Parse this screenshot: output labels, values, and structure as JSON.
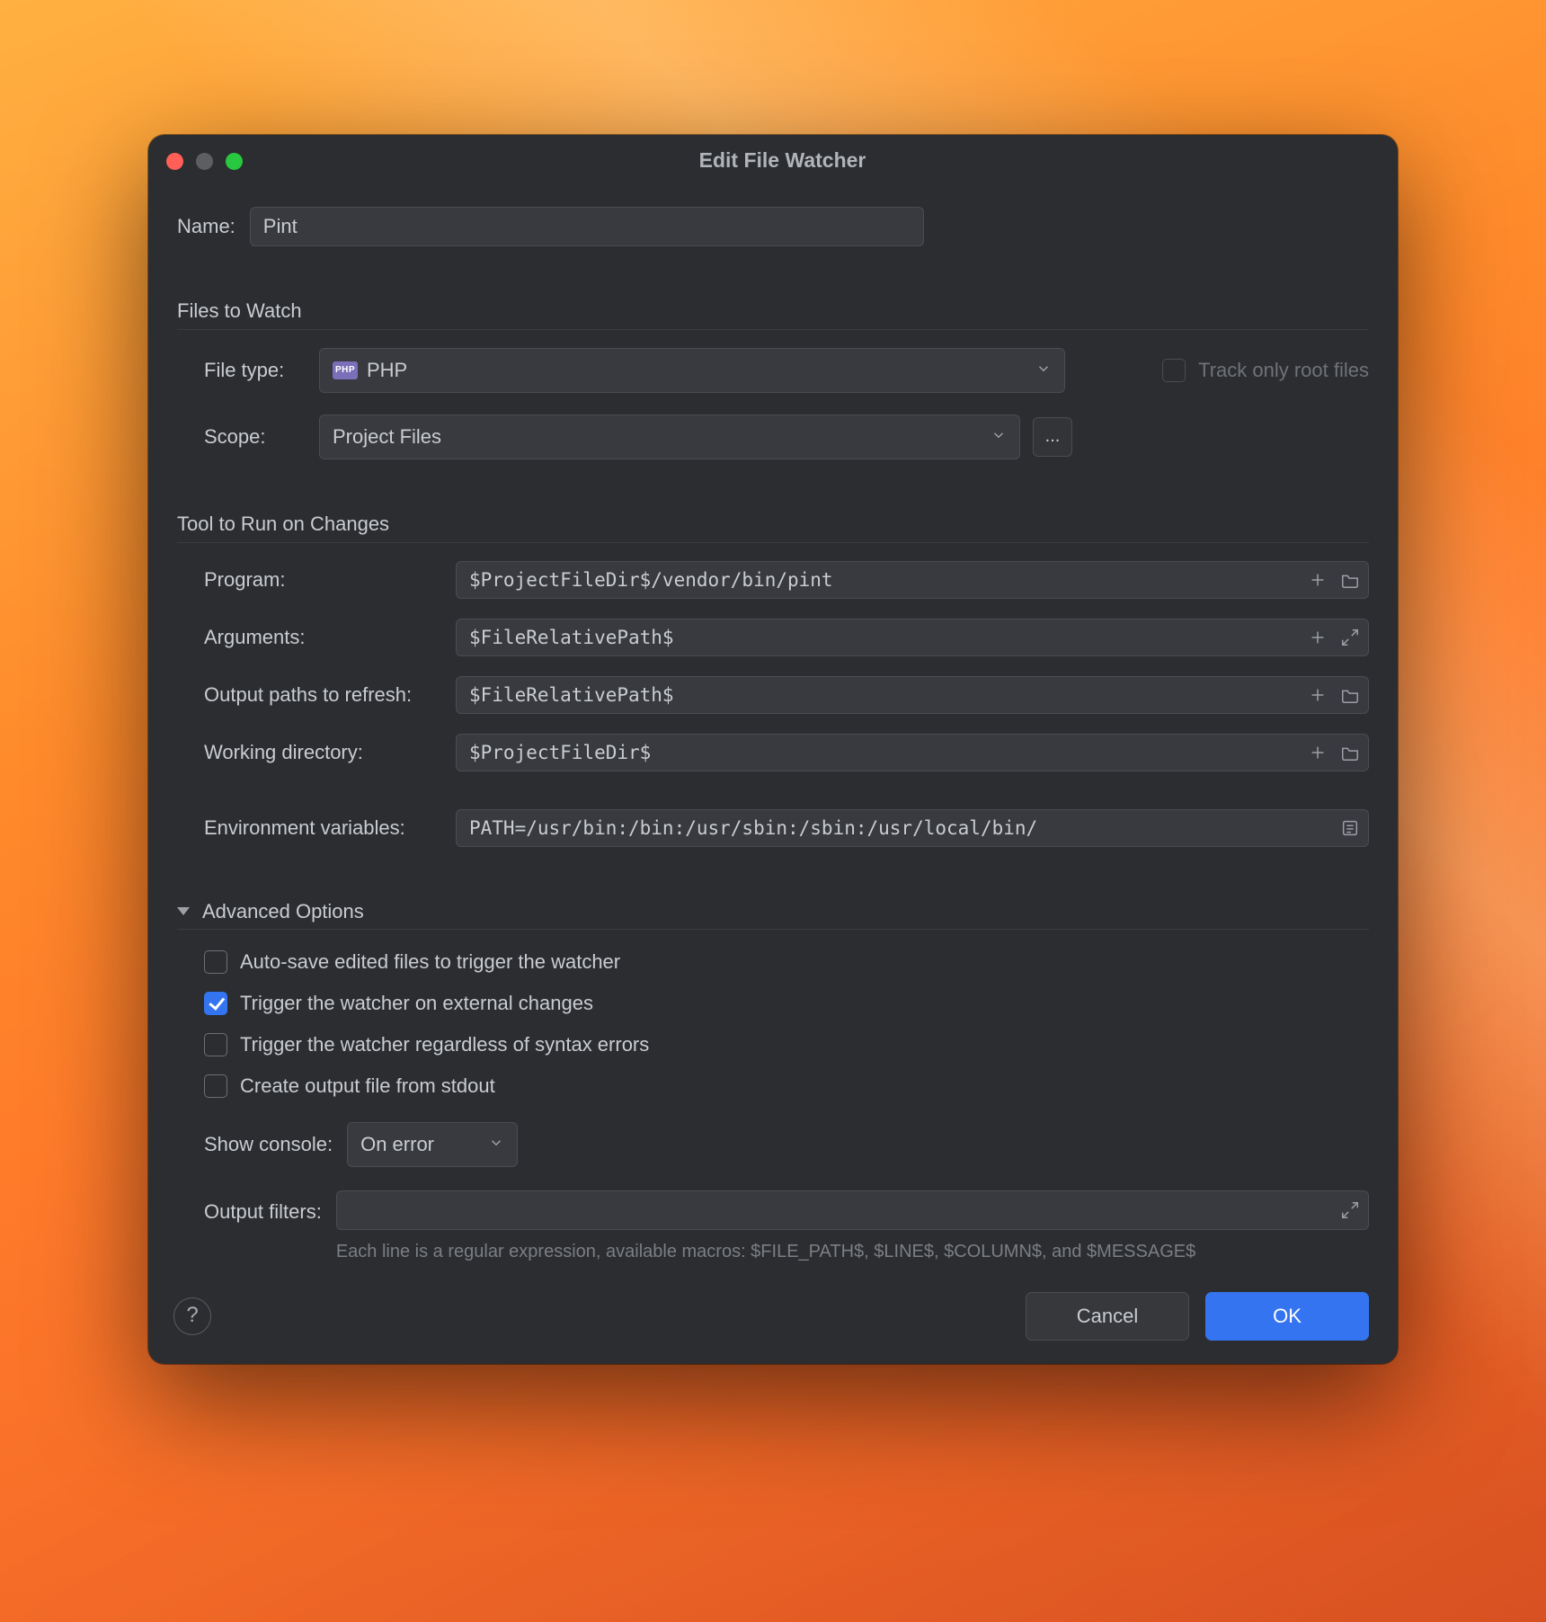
{
  "dialog": {
    "title": "Edit File Watcher",
    "name_label": "Name:",
    "name_value": "Pint"
  },
  "files_to_watch": {
    "heading": "Files to Watch",
    "file_type_label": "File type:",
    "file_type_value": "PHP",
    "scope_label": "Scope:",
    "scope_value": "Project Files",
    "track_root_label": "Track only root files"
  },
  "tool": {
    "heading": "Tool to Run on Changes",
    "program_label": "Program:",
    "program_value": "$ProjectFileDir$/vendor/bin/pint",
    "arguments_label": "Arguments:",
    "arguments_value": "$FileRelativePath$",
    "output_paths_label": "Output paths to refresh:",
    "output_paths_value": "$FileRelativePath$",
    "working_dir_label": "Working directory:",
    "working_dir_value": "$ProjectFileDir$",
    "env_label": "Environment variables:",
    "env_value": "PATH=/usr/bin:/bin:/usr/sbin:/sbin:/usr/local/bin/"
  },
  "advanced": {
    "heading": "Advanced Options",
    "auto_save": "Auto-save edited files to trigger the watcher",
    "trigger_external": "Trigger the watcher on external changes",
    "regardless_errors": "Trigger the watcher regardless of syntax errors",
    "create_output": "Create output file from stdout",
    "show_console_label": "Show console:",
    "show_console_value": "On error",
    "output_filters_label": "Output filters:",
    "output_filters_value": "",
    "hint": "Each line is a regular expression, available macros: $FILE_PATH$, $LINE$, $COLUMN$, and $MESSAGE$"
  },
  "footer": {
    "cancel": "Cancel",
    "ok": "OK"
  },
  "ellipsis": "..."
}
